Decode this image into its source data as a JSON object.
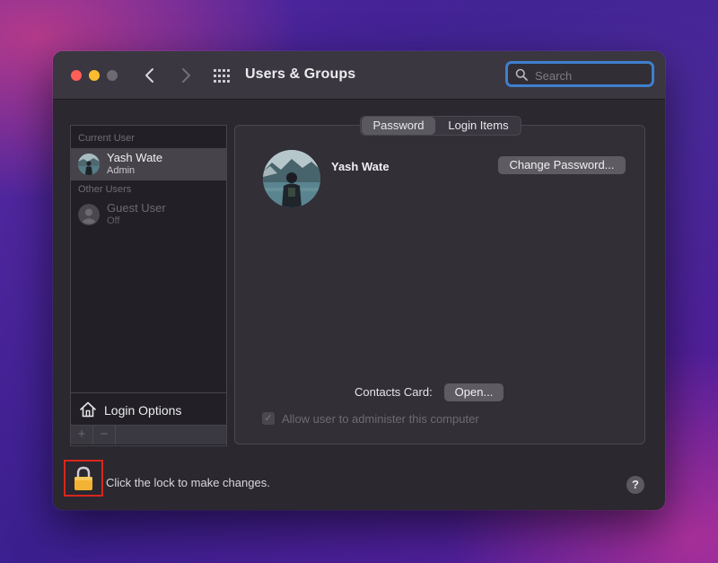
{
  "window": {
    "title": "Users & Groups"
  },
  "search": {
    "placeholder": "Search"
  },
  "sidebar": {
    "current_user_label": "Current User",
    "other_users_label": "Other Users",
    "current_user": {
      "name": "Yash Wate",
      "role": "Admin"
    },
    "other_users": [
      {
        "name": "Guest User",
        "status": "Off"
      }
    ],
    "login_options_label": "Login Options",
    "add_label": "+",
    "remove_label": "−"
  },
  "tabs": [
    {
      "label": "Password",
      "selected": true
    },
    {
      "label": "Login Items",
      "selected": false
    }
  ],
  "detail": {
    "user_name": "Yash Wate",
    "change_password_label": "Change Password...",
    "contacts_card_label": "Contacts Card:",
    "open_label": "Open...",
    "allow_admin_label": "Allow user to administer this computer",
    "allow_admin_checked": true,
    "checkmark": "✓"
  },
  "footer": {
    "lock_text": "Click the lock to make changes.",
    "help_label": "?"
  },
  "colors": {
    "accent": "#3f7fcf",
    "lock_highlight": "#d9261c",
    "lock_gold": "#f2b233"
  }
}
